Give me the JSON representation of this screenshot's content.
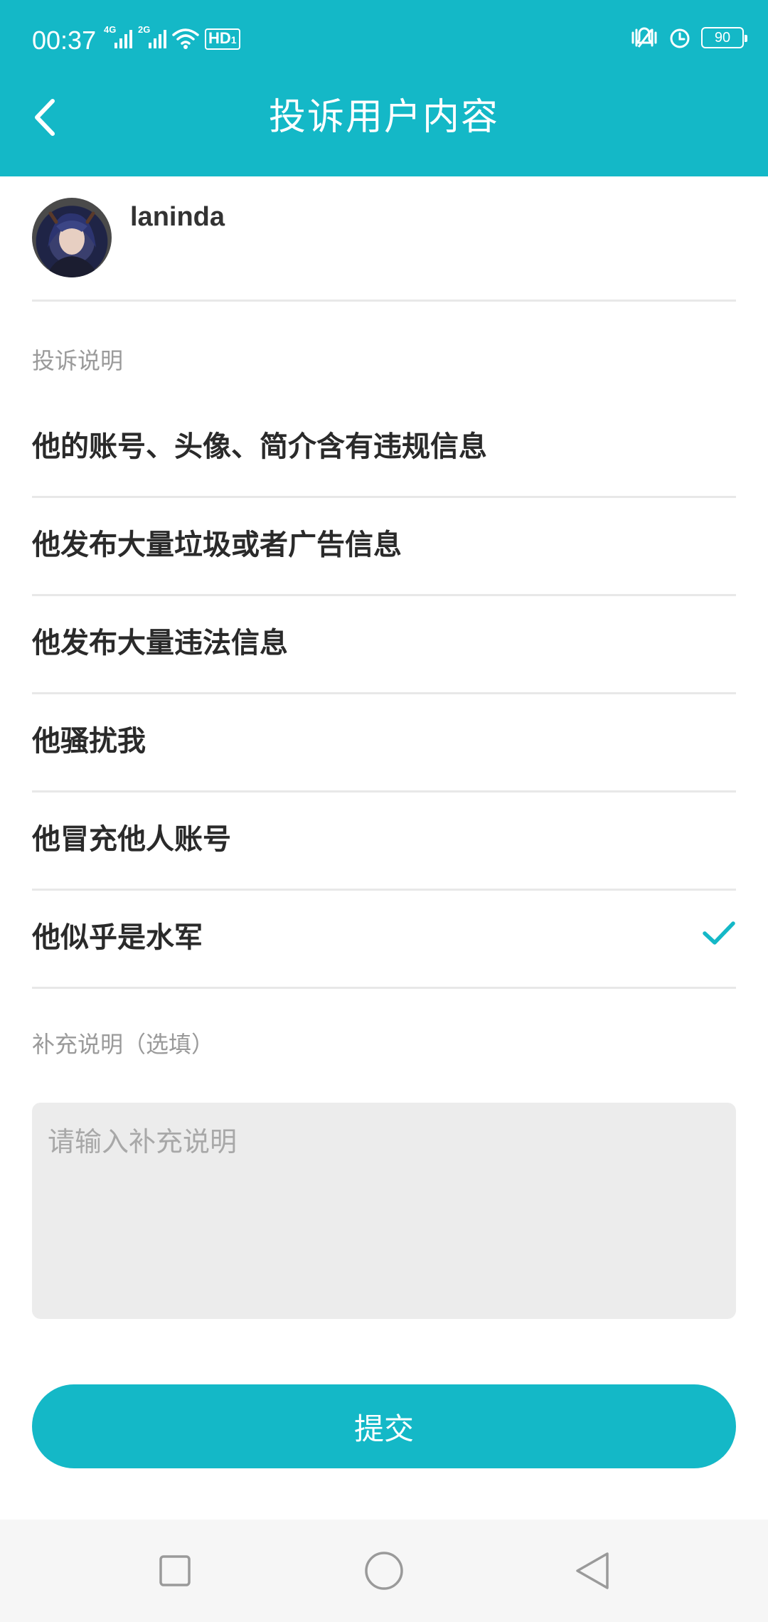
{
  "status_bar": {
    "time": "00:37",
    "signal_1": "4G",
    "signal_2": "2G",
    "hd": "HD",
    "hd_sub": "1",
    "battery": "90"
  },
  "header": {
    "title": "投诉用户内容",
    "back_icon": "chevron-left-icon"
  },
  "user": {
    "name": "laninda"
  },
  "reason_section": {
    "label": "投诉说明",
    "options": [
      {
        "label": "他的账号、头像、简介含有违规信息",
        "selected": false
      },
      {
        "label": "他发布大量垃圾或者广告信息",
        "selected": false
      },
      {
        "label": "他发布大量违法信息",
        "selected": false
      },
      {
        "label": "他骚扰我",
        "selected": false
      },
      {
        "label": "他冒充他人账号",
        "selected": false
      },
      {
        "label": "他似乎是水军",
        "selected": true
      }
    ]
  },
  "extra_section": {
    "label": "补充说明（选填）",
    "placeholder": "请输入补充说明",
    "value": ""
  },
  "submit_label": "提交",
  "colors": {
    "accent": "#14b8c7",
    "divider": "#e8e8e8",
    "muted_text": "#9a9a9a",
    "input_bg": "#ececec"
  },
  "nav_bar": {
    "icons": [
      "square-recent-apps-icon",
      "circle-home-icon",
      "triangle-back-icon"
    ]
  }
}
